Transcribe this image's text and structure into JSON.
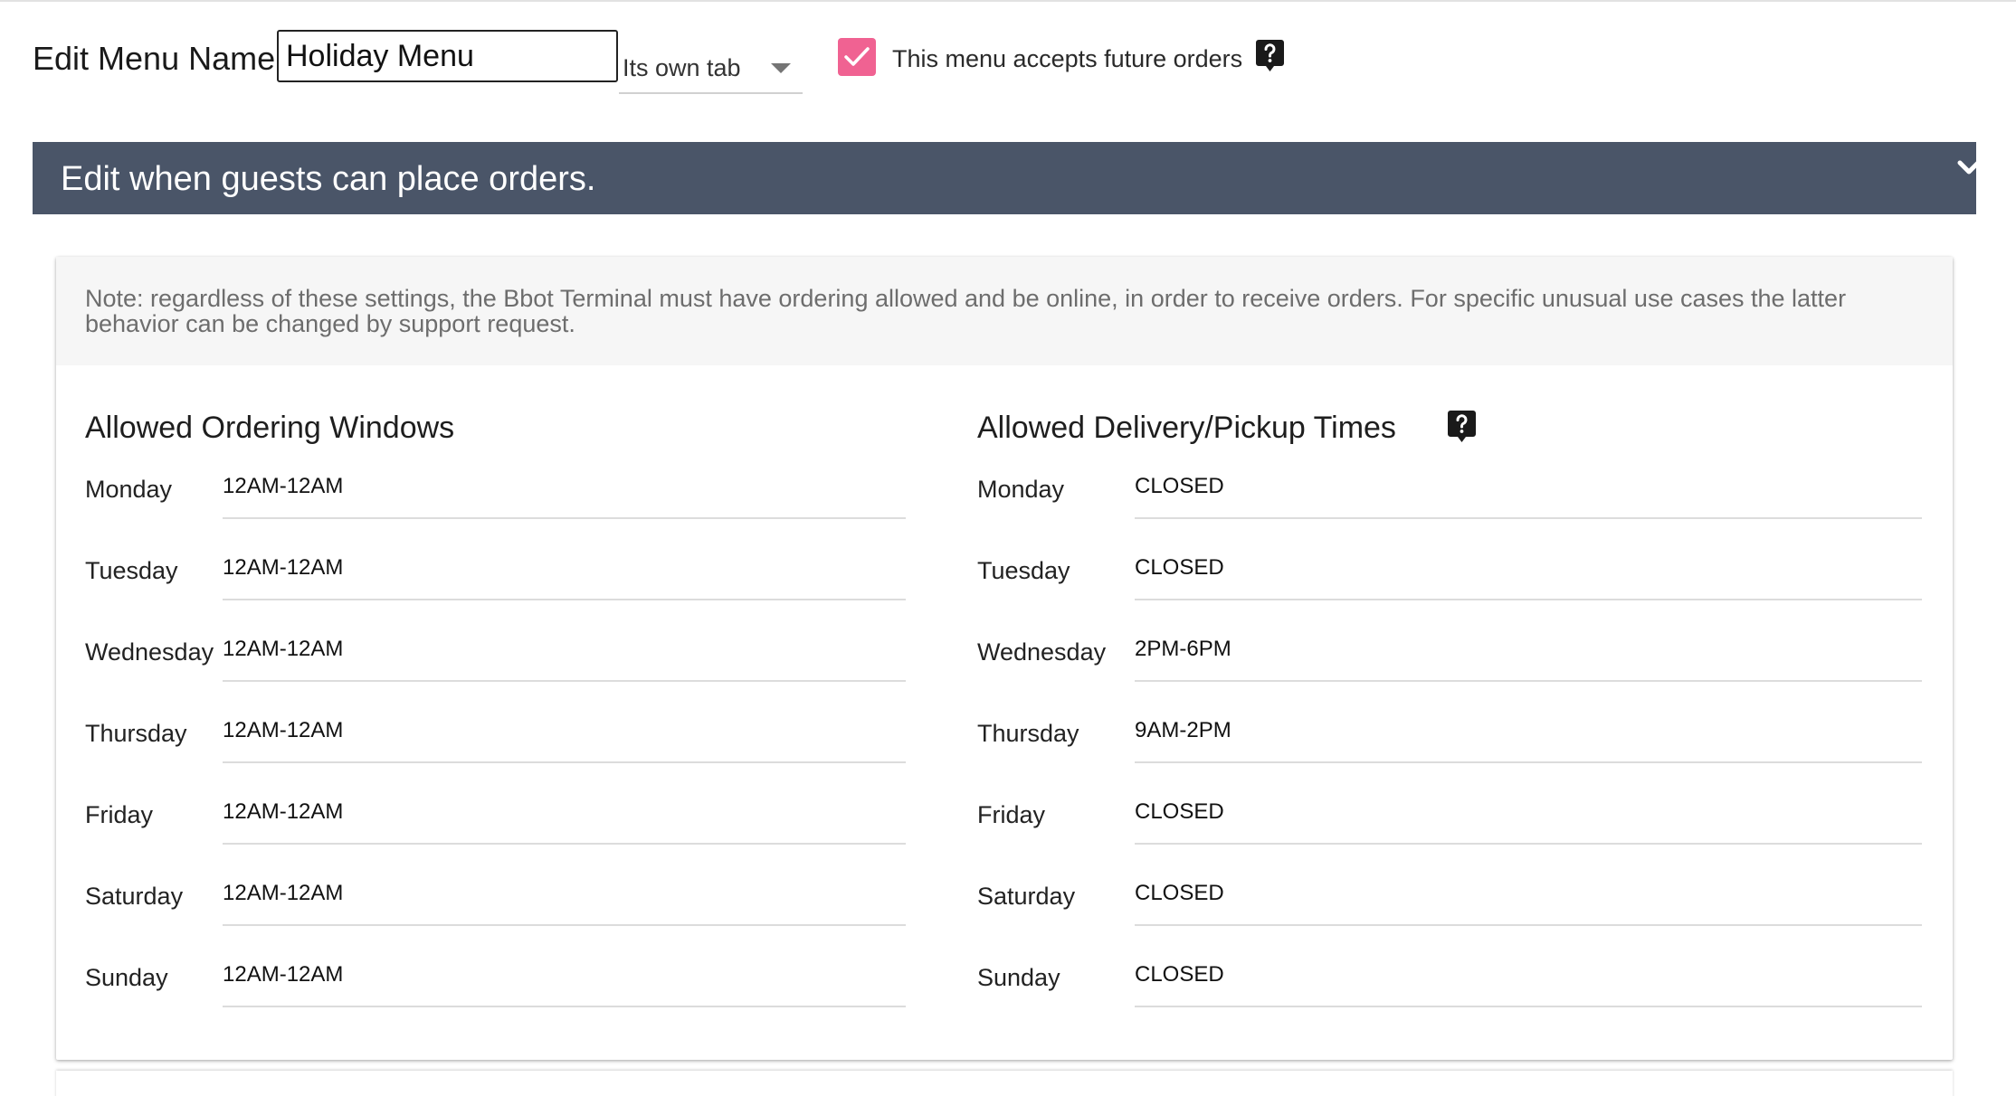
{
  "header": {
    "menu_name_label": "Edit Menu Name:",
    "menu_name_value": "Holiday Menu",
    "tab_option": "Its own tab",
    "future_orders": {
      "label": "This menu accepts future orders",
      "checked": true
    }
  },
  "banner": {
    "title": "Edit when guests can place orders."
  },
  "card": {
    "note": "Note: regardless of these settings, the Bbot Terminal must have ordering allowed and be online, in order to receive orders. For specific unusual use cases the latter behavior can be changed by support request.",
    "ordering": {
      "heading": "Allowed Ordering Windows",
      "days": [
        {
          "day": "Monday",
          "time": "12AM-12AM"
        },
        {
          "day": "Tuesday",
          "time": "12AM-12AM"
        },
        {
          "day": "Wednesday",
          "time": "12AM-12AM"
        },
        {
          "day": "Thursday",
          "time": "12AM-12AM"
        },
        {
          "day": "Friday",
          "time": "12AM-12AM"
        },
        {
          "day": "Saturday",
          "time": "12AM-12AM"
        },
        {
          "day": "Sunday",
          "time": "12AM-12AM"
        }
      ]
    },
    "delivery": {
      "heading": "Allowed Delivery/Pickup Times",
      "days": [
        {
          "day": "Monday",
          "time": "CLOSED"
        },
        {
          "day": "Tuesday",
          "time": "CLOSED"
        },
        {
          "day": "Wednesday",
          "time": "2PM-6PM"
        },
        {
          "day": "Thursday",
          "time": "9AM-2PM"
        },
        {
          "day": "Friday",
          "time": "CLOSED"
        },
        {
          "day": "Saturday",
          "time": "CLOSED"
        },
        {
          "day": "Sunday",
          "time": "CLOSED"
        }
      ]
    }
  },
  "colors": {
    "banner": "#4a5568",
    "checkbox": "#f06292",
    "note_bg": "#f6f6f6"
  },
  "icons": [
    "check-icon",
    "help-icon",
    "chevron-down-icon",
    "dropdown-arrow-icon"
  ]
}
